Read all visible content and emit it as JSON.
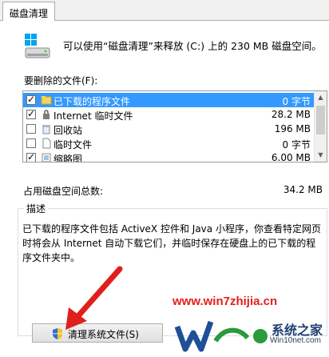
{
  "tabs": [
    {
      "label": "磁盘清理"
    }
  ],
  "header": {
    "text": "可以使用“磁盘清理”来释放  (C:) 上的 230 MB 磁盘空间。"
  },
  "files_section": {
    "label": "要删除的文件(F):",
    "items": [
      {
        "name": "已下载的程序文件",
        "size": "0 字节",
        "checked": true,
        "selected": true,
        "icon": "folder-icon"
      },
      {
        "name": "Internet 临时文件",
        "size": "28.2 MB",
        "checked": true,
        "selected": false,
        "icon": "ie-lock-icon"
      },
      {
        "name": "回收站",
        "size": "196 MB",
        "checked": false,
        "selected": false,
        "icon": "recycle-bin-icon"
      },
      {
        "name": "临时文件",
        "size": "0 字节",
        "checked": false,
        "selected": false,
        "icon": "file-icon"
      },
      {
        "name": "缩略图",
        "size": "6.00 MB",
        "checked": true,
        "selected": false,
        "icon": "thumbnail-icon"
      }
    ]
  },
  "total": {
    "label": "占用磁盘空间总数:",
    "value": "34.2 MB"
  },
  "description": {
    "title": "描述",
    "text": "已下载的程序文件包括 ActiveX 控件和 Java 小程序，你查看特定网页时将会从 Internet 自动下载它们，并临时保存在硬盘上的已下载的程序文件夹中。"
  },
  "buttons": {
    "clean_system_files": "清理系统文件(S)"
  },
  "watermark": {
    "url": "www.win7zhijia.cn",
    "brand": "系统之家",
    "site": "Win10net.com"
  },
  "colors": {
    "selection": "#3399ff",
    "arrow": "#e0201c",
    "watermark_url": "#e0201c"
  }
}
